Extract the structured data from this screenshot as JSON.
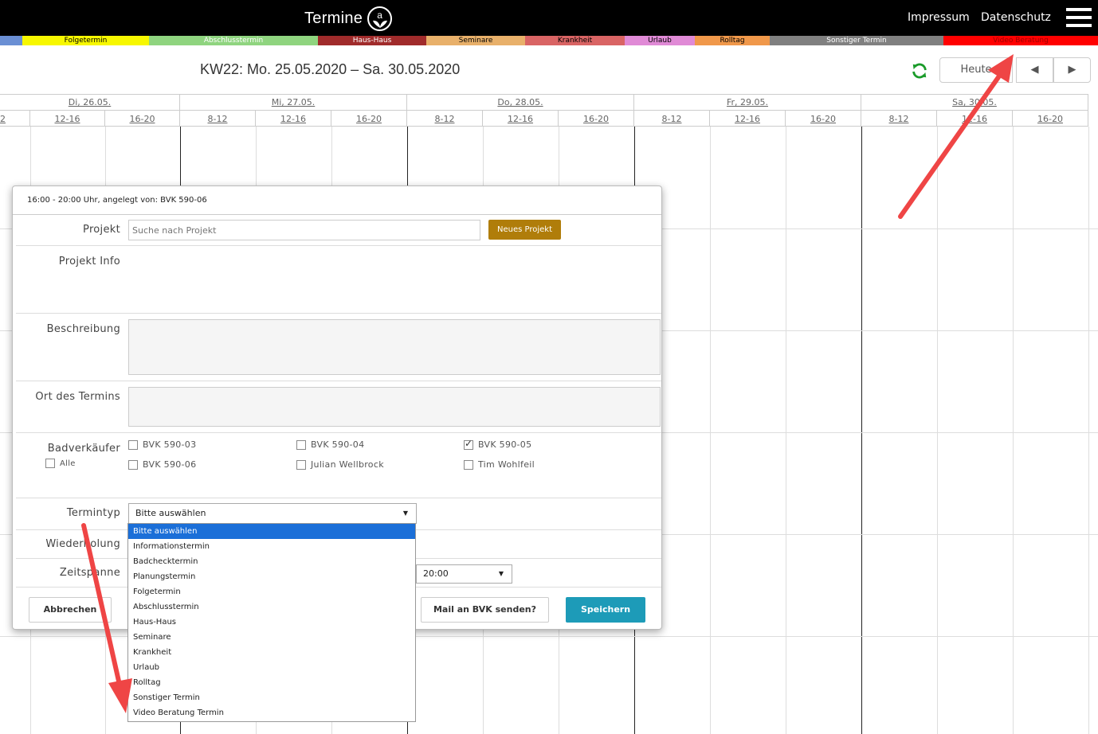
{
  "header": {
    "brand": "Termine",
    "brand_logo_letter": "a",
    "nav": [
      "Impressum",
      "Datenschutz"
    ]
  },
  "legend": [
    {
      "label": "",
      "color": "#6a8fd4",
      "text": "#000"
    },
    {
      "label": "Folgetermin",
      "color": "#f7f700",
      "text": "#000"
    },
    {
      "label": "Abschlusstermin",
      "color": "#8fd47f",
      "text": "#fff"
    },
    {
      "label": "Haus-Haus",
      "color": "#a02b2b",
      "text": "#fff"
    },
    {
      "label": "Seminare",
      "color": "#e8b06a",
      "text": "#000"
    },
    {
      "label": "Krankheit",
      "color": "#d96464",
      "text": "#000"
    },
    {
      "label": "Urlaub",
      "color": "#e08ad6",
      "text": "#000"
    },
    {
      "label": "Rolltag",
      "color": "#f0984a",
      "text": "#000"
    },
    {
      "label": "Sonstiger Termin",
      "color": "#808080",
      "text": "#fff"
    },
    {
      "label": "Video Beratung",
      "color": "#ff0000",
      "text": "#a00000"
    }
  ],
  "week": {
    "title": "KW22: Mo. 25.05.2020 – Sa. 30.05.2020",
    "today_button": "Heute",
    "prev_icon": "◀",
    "next_icon": "▶"
  },
  "calendar": {
    "days": [
      "Di, 26.05.",
      "Mi, 27.05.",
      "Do, 28.05.",
      "Fr, 29.05.",
      "Sa, 30.05."
    ],
    "slots": [
      "8-12",
      "12-16",
      "16-20"
    ],
    "partial_slot": "2"
  },
  "modal": {
    "header": "16:00 - 20:00 Uhr, angelegt von: BVK 590-06",
    "projekt_label": "Projekt",
    "projekt_placeholder": "Suche nach Projekt",
    "new_project_button": "Neues Projekt",
    "projekt_info_label": "Projekt Info",
    "beschreibung_label": "Beschreibung",
    "ort_label": "Ort des Termins",
    "badverkaeufer_label": "Badverkäufer",
    "alle_label": "Alle",
    "sellers": [
      {
        "name": "BVK 590-03",
        "checked": false
      },
      {
        "name": "BVK 590-04",
        "checked": false
      },
      {
        "name": "BVK 590-05",
        "checked": true
      },
      {
        "name": "BVK 590-06",
        "checked": false
      },
      {
        "name": "Julian Wellbrock",
        "checked": false
      },
      {
        "name": "Tim Wohlfeil",
        "checked": false
      }
    ],
    "termintyp_label": "Termintyp",
    "termintyp_value": "Bitte auswählen",
    "wiederholung_label": "Wiederholung",
    "zeitspanne_label": "Zeitspanne",
    "zeitspanne_end": "20:00",
    "cancel_button": "Abbrechen",
    "mail_button": "Mail an BVK senden?",
    "save_button": "Speichern"
  },
  "termintyp_options": [
    "Bitte auswählen",
    "Informationstermin",
    "Badchecktermin",
    "Planungstermin",
    "Folgetermin",
    "Abschlusstermin",
    "Haus-Haus",
    "Seminare",
    "Krankheit",
    "Urlaub",
    "Rolltag",
    "Sonstiger Termin",
    "Video Beratung Termin"
  ]
}
